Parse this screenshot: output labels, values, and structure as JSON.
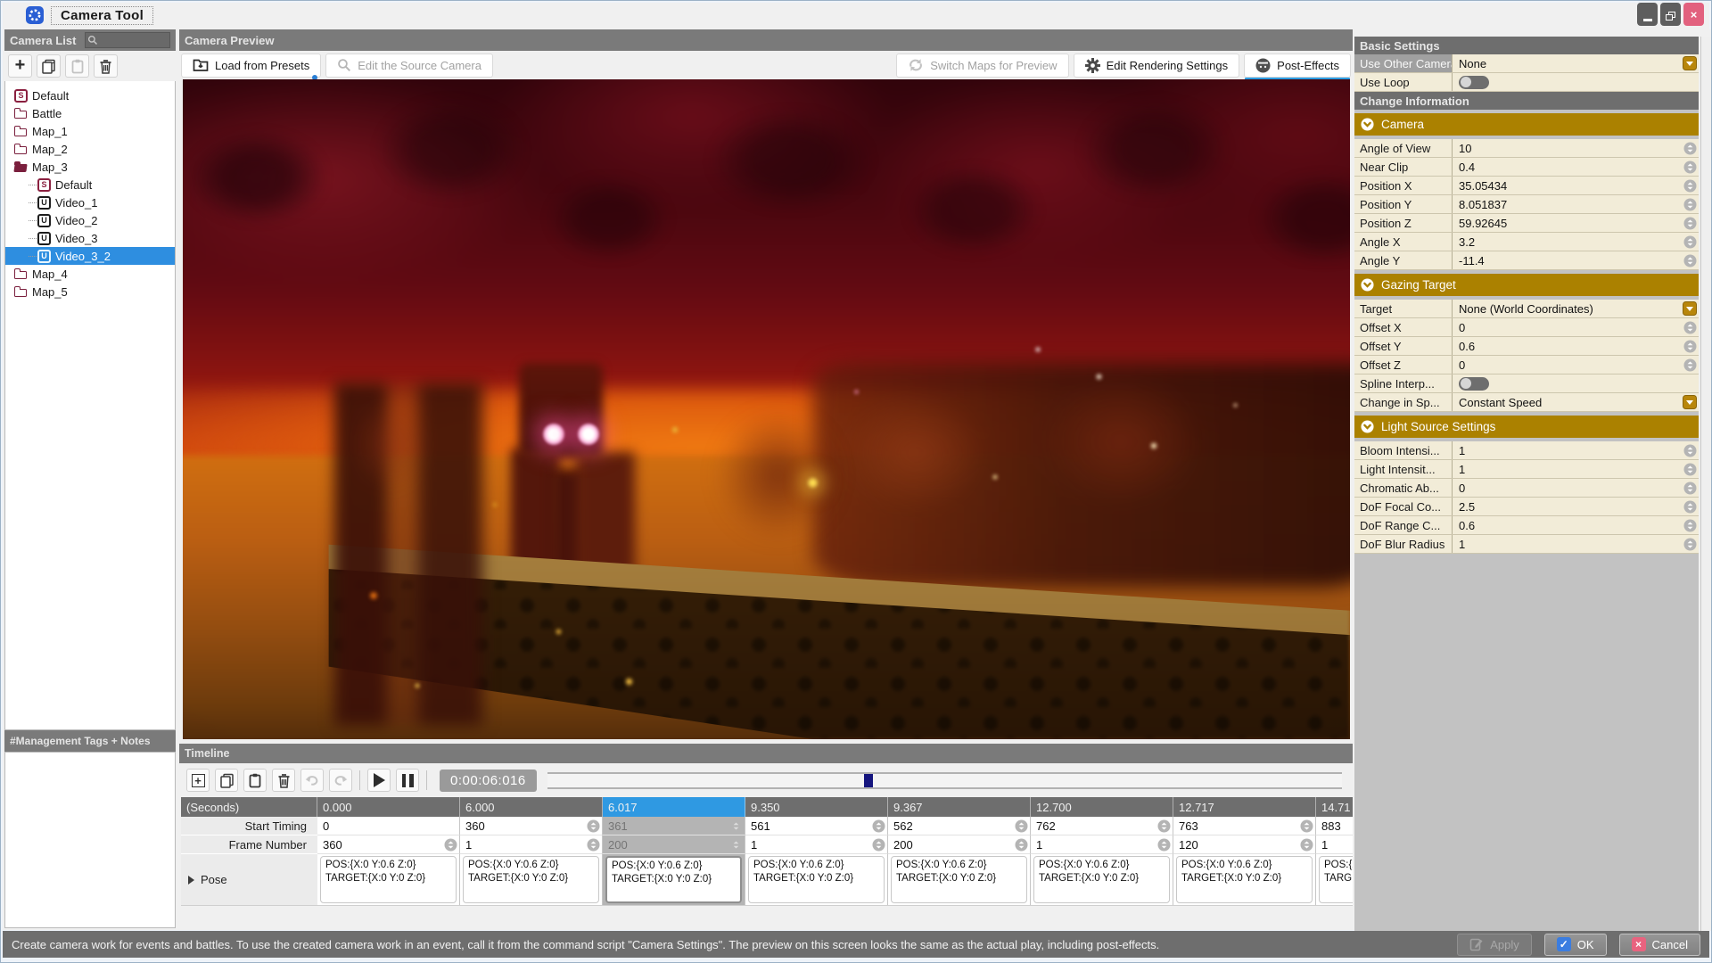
{
  "window": {
    "title": "Camera Tool",
    "controls": {
      "minimize": "minimize",
      "maximize": "maximize",
      "close": "close"
    }
  },
  "colors": {
    "selection_blue": "#2e8ee0",
    "section_gold": "#ab8100",
    "tab_underline_blue": "#2b9ce2",
    "playhead_navy": "#15157e",
    "close_button_pink": "#e2617e"
  },
  "camera_list": {
    "title": "Camera List",
    "search_value": "",
    "notes_header": "#Management Tags + Notes",
    "toolbar": [
      "add",
      "duplicate",
      "paste",
      "delete"
    ],
    "tree": [
      {
        "label": "Default",
        "icon": "script",
        "depth": 0,
        "selected": false
      },
      {
        "label": "Battle",
        "icon": "folder",
        "depth": 0,
        "selected": false
      },
      {
        "label": "Map_1",
        "icon": "folder",
        "depth": 0,
        "selected": false
      },
      {
        "label": "Map_2",
        "icon": "folder",
        "depth": 0,
        "selected": false
      },
      {
        "label": "Map_3",
        "icon": "folder-open",
        "depth": 0,
        "selected": false
      },
      {
        "label": "Default",
        "icon": "script",
        "depth": 1,
        "selected": false
      },
      {
        "label": "Video_1",
        "icon": "video",
        "depth": 1,
        "selected": false
      },
      {
        "label": "Video_2",
        "icon": "video",
        "depth": 1,
        "selected": false
      },
      {
        "label": "Video_3",
        "icon": "video",
        "depth": 1,
        "selected": false
      },
      {
        "label": "Video_3_2",
        "icon": "video",
        "depth": 1,
        "selected": true
      },
      {
        "label": "Map_4",
        "icon": "folder",
        "depth": 0,
        "selected": false
      },
      {
        "label": "Map_5",
        "icon": "folder",
        "depth": 0,
        "selected": false
      }
    ]
  },
  "preview": {
    "title": "Camera Preview",
    "load_from_presets": "Load from Presets",
    "edit_source_camera": "Edit the Source Camera",
    "switch_maps": "Switch Maps for Preview",
    "edit_rendering": "Edit Rendering Settings",
    "post_effects": "Post-Effects"
  },
  "timeline": {
    "title": "Timeline",
    "time_display": "0:00:06:016",
    "playhead_percent": 40.4,
    "row_labels": {
      "seconds": "(Seconds)",
      "start_timing": "Start Timing",
      "frame_number": "Frame Number",
      "pose": "Pose"
    },
    "pose_text": "POS:{X:0 Y:0.6 Z:0} TARGET:{X:0 Y:0 Z:0}",
    "columns": [
      {
        "seconds": "0.000",
        "start": "0",
        "frame": "360",
        "start_spin": false,
        "frame_spin": true,
        "selected": false
      },
      {
        "seconds": "6.000",
        "start": "360",
        "frame": "1",
        "start_spin": true,
        "frame_spin": true,
        "selected": false
      },
      {
        "seconds": "6.017",
        "start": "361",
        "frame": "200",
        "start_spin": true,
        "frame_spin": true,
        "selected": true
      },
      {
        "seconds": "9.350",
        "start": "561",
        "frame": "1",
        "start_spin": true,
        "frame_spin": true,
        "selected": false
      },
      {
        "seconds": "9.367",
        "start": "562",
        "frame": "200",
        "start_spin": true,
        "frame_spin": true,
        "selected": false
      },
      {
        "seconds": "12.700",
        "start": "762",
        "frame": "1",
        "start_spin": true,
        "frame_spin": true,
        "selected": false
      },
      {
        "seconds": "12.717",
        "start": "763",
        "frame": "120",
        "start_spin": true,
        "frame_spin": true,
        "selected": false
      },
      {
        "seconds": "14.71",
        "start": "883",
        "frame": "1",
        "start_spin": false,
        "frame_spin": false,
        "selected": false
      }
    ]
  },
  "settings": {
    "rows": [
      {
        "kind": "header",
        "label": "Basic Settings"
      },
      {
        "kind": "dropdown",
        "label": "Use Other Camera",
        "value": "None",
        "label_gray": true
      },
      {
        "kind": "toggle",
        "label": "Use Loop",
        "on": false
      },
      {
        "kind": "header",
        "label": "Change Information"
      },
      {
        "kind": "section",
        "label": "Camera"
      },
      {
        "kind": "spin",
        "label": "Angle of View",
        "value": "10"
      },
      {
        "kind": "spin",
        "label": "Near Clip",
        "value": "0.4"
      },
      {
        "kind": "spin",
        "label": "Position X",
        "value": "35.05434"
      },
      {
        "kind": "spin",
        "label": "Position Y",
        "value": "8.051837"
      },
      {
        "kind": "spin",
        "label": "Position Z",
        "value": "59.92645"
      },
      {
        "kind": "spin",
        "label": "Angle X",
        "value": "3.2"
      },
      {
        "kind": "spin",
        "label": "Angle Y",
        "value": "-11.4"
      },
      {
        "kind": "section",
        "label": "Gazing Target"
      },
      {
        "kind": "dropdown",
        "label": "Target",
        "value": "None (World Coordinates)"
      },
      {
        "kind": "spin",
        "label": "Offset X",
        "value": "0"
      },
      {
        "kind": "spin",
        "label": "Offset Y",
        "value": "0.6"
      },
      {
        "kind": "spin",
        "label": "Offset Z",
        "value": "0"
      },
      {
        "kind": "toggle",
        "label": "Spline Interp...",
        "on": false
      },
      {
        "kind": "dropdown",
        "label": "Change in Sp...",
        "value": "Constant Speed"
      },
      {
        "kind": "section",
        "label": "Light Source Settings"
      },
      {
        "kind": "spin",
        "label": "Bloom Intensi...",
        "value": "1"
      },
      {
        "kind": "spin",
        "label": "Light Intensit...",
        "value": "1"
      },
      {
        "kind": "spin",
        "label": "Chromatic Ab...",
        "value": "0"
      },
      {
        "kind": "spin",
        "label": "DoF Focal Co...",
        "value": "2.5"
      },
      {
        "kind": "spin",
        "label": "DoF Range C...",
        "value": "0.6"
      },
      {
        "kind": "spin",
        "label": "DoF Blur Radius",
        "value": "1"
      }
    ]
  },
  "footer": {
    "help_text": "Create camera work for events and battles. To use the created camera work in an event, call it from the command script \"Camera Settings\". The preview on this screen looks the same as the actual play, including post-effects.",
    "apply": "Apply",
    "ok": "OK",
    "cancel": "Cancel"
  }
}
